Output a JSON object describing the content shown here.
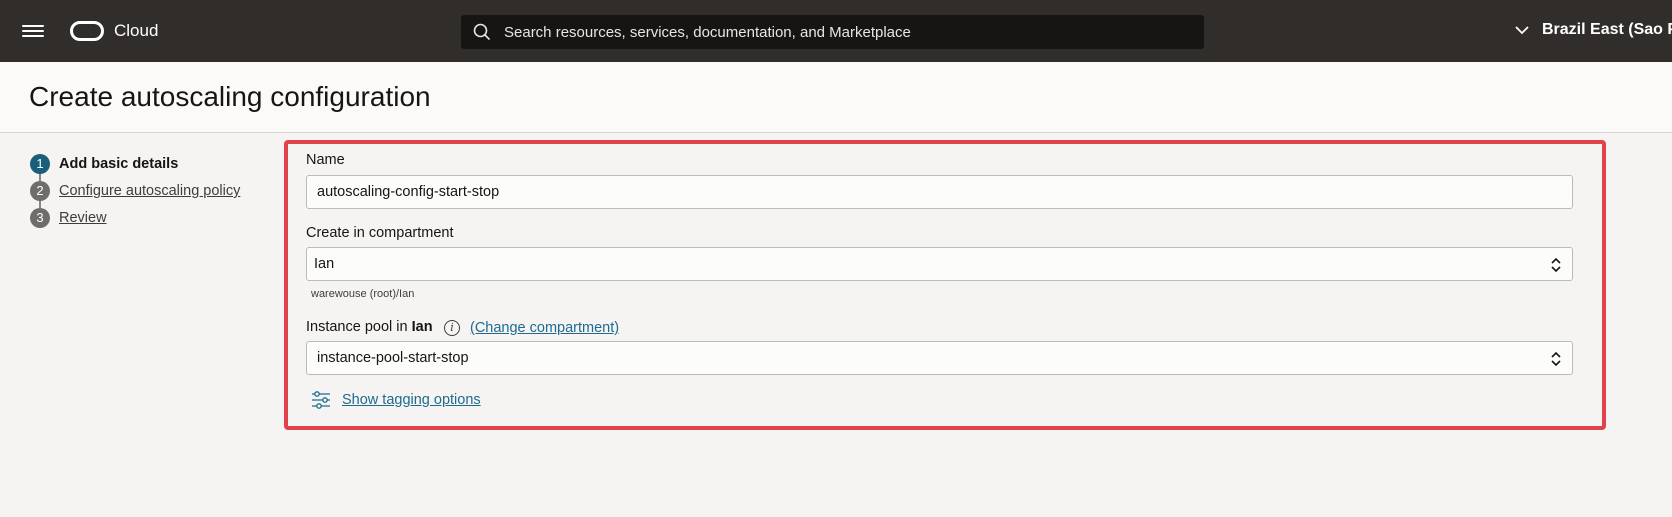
{
  "topbar": {
    "brand": "Cloud",
    "search_placeholder": "Search resources, services, documentation, and Marketplace",
    "region": "Brazil East (Sao Paulo)"
  },
  "page": {
    "title": "Create autoscaling configuration"
  },
  "steps": [
    {
      "number": "1",
      "label": "Add basic details",
      "active": true
    },
    {
      "number": "2",
      "label": "Configure autoscaling policy",
      "active": false
    },
    {
      "number": "3",
      "label": "Review",
      "active": false
    }
  ],
  "form": {
    "name_label": "Name",
    "name_value": "autoscaling-config-start-stop",
    "compartment_label": "Create in compartment",
    "compartment_value": "Ian",
    "compartment_path": "warewouse (root)/Ian",
    "pool_label_prefix": "Instance pool in",
    "pool_label_compartment": "Ian",
    "change_compartment_link": "(Change compartment)",
    "pool_value": "instance-pool-start-stop",
    "tagging_link": "Show tagging options"
  },
  "colors": {
    "topbar_bg": "#312d2a",
    "active_step": "#1a5f79",
    "highlight_frame": "#e0434c",
    "link": "#1e6b8f"
  }
}
